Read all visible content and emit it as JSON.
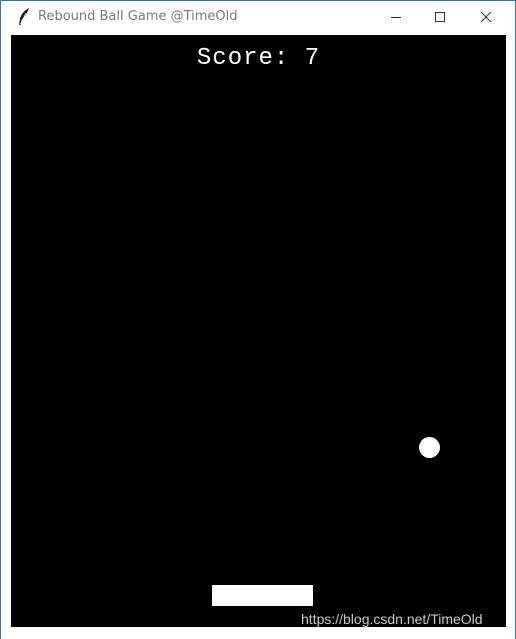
{
  "window": {
    "title": "Rebound Ball Game @TimeOld",
    "icon": "feather-icon",
    "controls": [
      "minimize-icon",
      "maximize-icon",
      "close-icon"
    ]
  },
  "game": {
    "score_text": "Score: 7",
    "background_color": "#000000",
    "foreground_color": "#ffffff"
  },
  "watermark": "https://blog.csdn.net/TimeOld"
}
